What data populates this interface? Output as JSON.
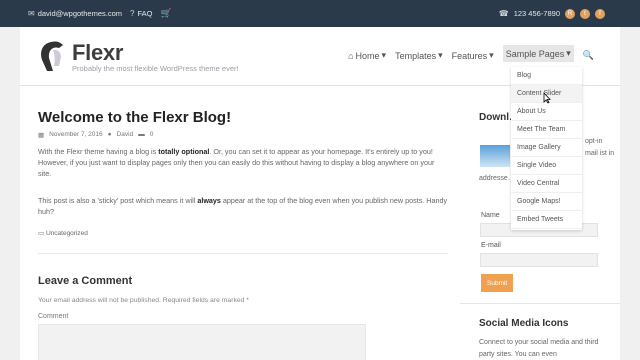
{
  "topbar": {
    "email": "david@wpgothemes.com",
    "faq": "FAQ",
    "phone": "123 456-7890",
    "social_icons": [
      "rss-icon",
      "twitter-icon",
      "facebook-icon"
    ]
  },
  "header": {
    "brand": "Flexr",
    "tagline": "Probably the most flexible WordPress theme ever!",
    "nav": [
      {
        "label": "Home"
      },
      {
        "label": "Templates"
      },
      {
        "label": "Features"
      },
      {
        "label": "Sample Pages"
      }
    ]
  },
  "dropdown": [
    "Blog",
    "Content Slider",
    "About Us",
    "Meet The Team",
    "Image Gallery",
    "Single Video",
    "Video Central",
    "Google Maps!",
    "Embed Tweets"
  ],
  "post": {
    "title": "Welcome to the Flexr Blog!",
    "date": "November 7, 2016",
    "author": "David",
    "comments": "0",
    "p1_a": "With the Flexr theme having a blog is ",
    "p1_b": "totally optional",
    "p1_c": ". Or, you can set it to appear as your homepage. It's entirely up to you! However, if you just want to display pages only then you can easily do this without having to display a blog anywhere on your site.",
    "p2_a": "This post is also a 'sticky' post which means it will ",
    "p2_b": "always",
    "p2_c": " appear at the top of the blog even when you publish new posts. Handy huh?",
    "category": "Uncategorized"
  },
  "comment": {
    "heading": "Leave a Comment",
    "note": "Your email address will not be published. Required fields are marked *",
    "label": "Comment"
  },
  "sidebar": {
    "heading": "Downl… Plan T…",
    "p1": "opt-in mail ist in",
    "p2": "addresse… your latest service!",
    "name_label": "Name",
    "email_label": "E-mail",
    "submit": "Submit",
    "social_heading": "Social Media Icons",
    "social_text": "Connect to your social media and third party sites. You can even"
  },
  "colors": {
    "topbar": "#2b3a4a",
    "accent": "#f0a14f",
    "cart": "#6ec07a"
  }
}
